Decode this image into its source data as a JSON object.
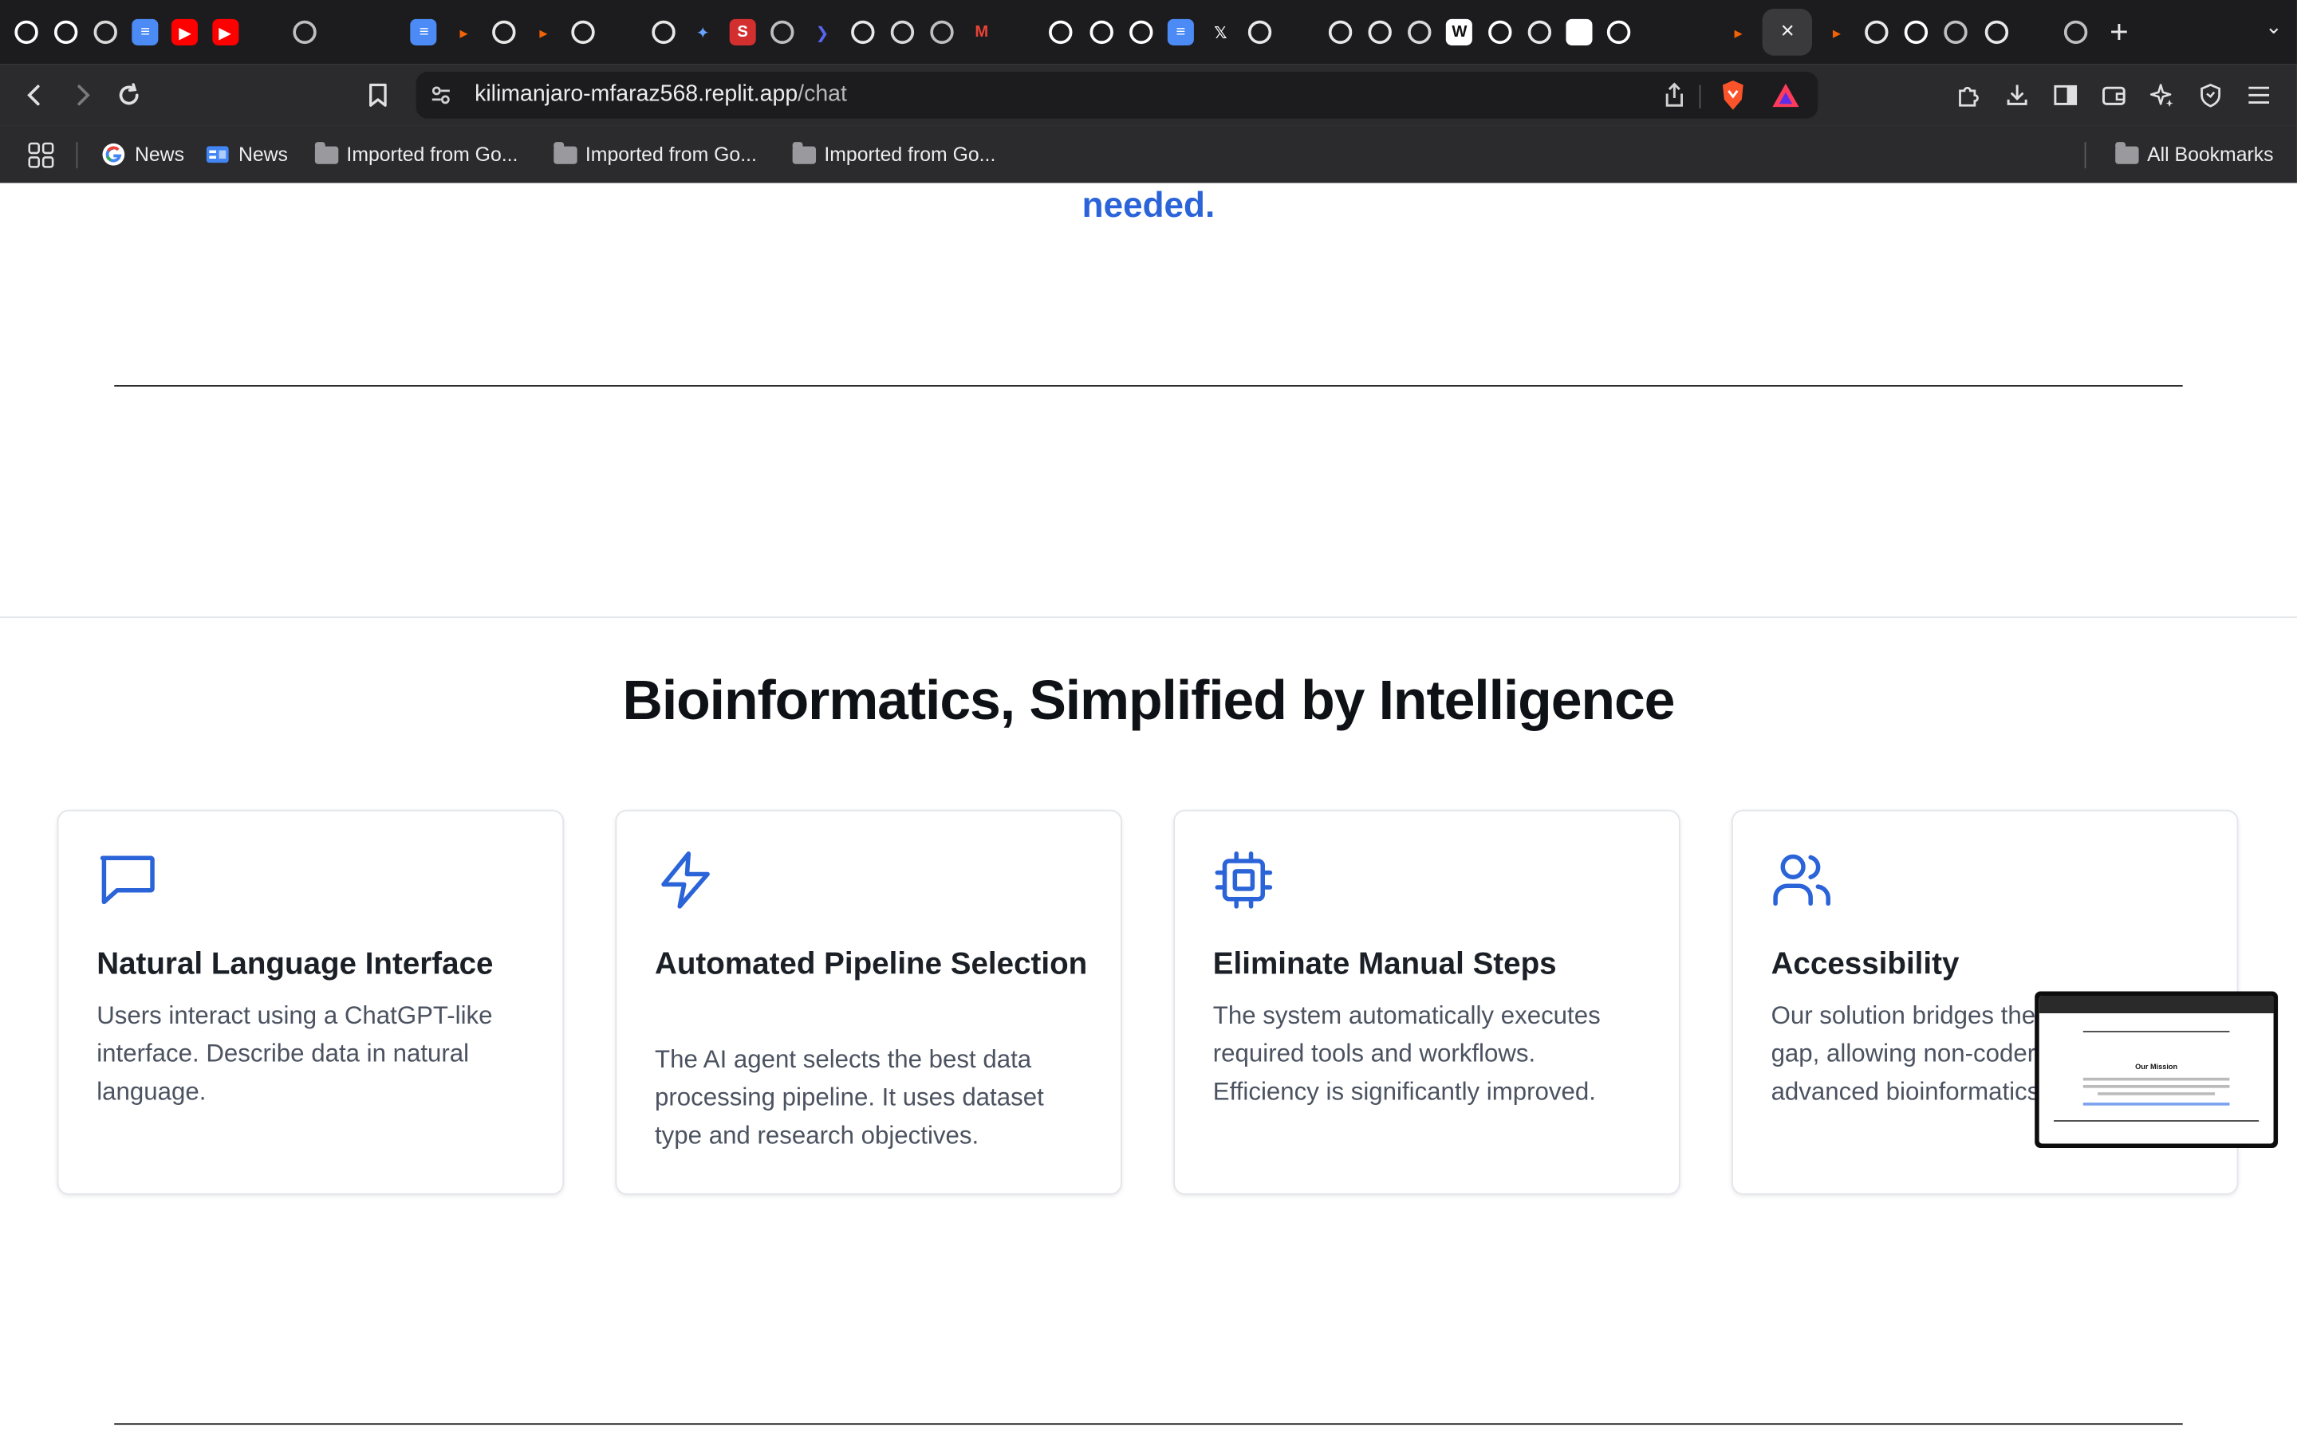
{
  "browser": {
    "tab_count_icons": [
      "github-icon",
      "github-icon",
      "perplexity-icon",
      "docs-icon",
      "youtube-icon",
      "youtube-icon",
      "proton-icon",
      "globe-icon",
      "image-icon",
      "stack-icon",
      "docs-icon",
      "replit-icon",
      "openai-icon",
      "replit-icon",
      "openai-icon",
      "copilot-icon",
      "openai-icon",
      "gemini-icon",
      "scholar-icon",
      "globe-icon",
      "arrow-icon",
      "openai-icon",
      "perplexity-icon",
      "globe-icon",
      "gmail-icon",
      "huggingface-icon",
      "github-icon",
      "github-icon",
      "github-icon",
      "docs-icon",
      "x-icon",
      "openai-icon",
      "stack-icon",
      "openai-icon",
      "openai-icon",
      "perplexity-icon",
      "wikipedia-icon",
      "github-icon",
      "openai-icon",
      "notion-icon",
      "github-icon",
      "whatsapp-icon",
      "stack-icon",
      "replit-icon"
    ],
    "tabs_after_active": [
      "replit-icon",
      "openai-icon",
      "github-icon",
      "globe-icon",
      "openai-icon",
      "whatsapp-icon",
      "globe-icon"
    ],
    "active_tab_close": "×",
    "new_tab": "+",
    "url_host": "kilimanjaro-mfaraz568.replit.app",
    "url_path": "/chat"
  },
  "bookmarks": {
    "items": [
      {
        "label": "News",
        "icon": "google-icon"
      },
      {
        "label": "News",
        "icon": "google-news-icon"
      },
      {
        "label": "Imported from Go...",
        "icon": "folder-icon"
      },
      {
        "label": "Imported from Go...",
        "icon": "folder-icon"
      },
      {
        "label": "Imported from Go...",
        "icon": "folder-icon"
      }
    ],
    "all_bookmarks": "All Bookmarks"
  },
  "page": {
    "top_fragment": "needed.",
    "section_title": "Bioinformatics, Simplified by Intelligence",
    "accent_color": "#2b63d9",
    "cards": [
      {
        "icon": "chat-bubble-icon",
        "title": "Natural Language Interface",
        "body": "Users interact using a ChatGPT-like interface. Describe data in natural language."
      },
      {
        "icon": "lightning-icon",
        "title": "Automated Pipeline Selection",
        "body": "The AI agent selects the best data processing pipeline. It uses dataset type and research objectives."
      },
      {
        "icon": "cpu-chip-icon",
        "title": "Eliminate Manual Steps",
        "body": "The system automatically executes required tools and workflows. Efficiency is significantly improved."
      },
      {
        "icon": "users-icon",
        "title": "Accessibility",
        "body": "Our solution bridges the accessibility gap, allowing non-coders to use advanced bioinformatics tools."
      }
    ],
    "thumbnail_title": "Our Mission"
  }
}
